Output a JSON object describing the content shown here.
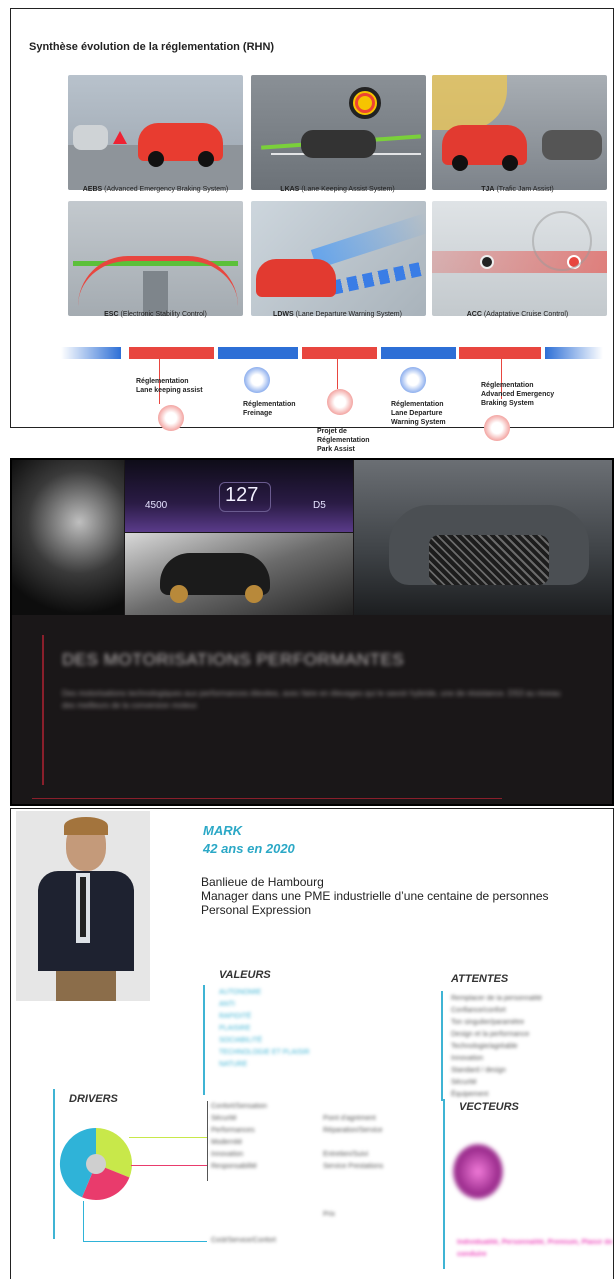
{
  "slide1": {
    "title": "Synthèse évolution de la réglementation (RHN)",
    "systems": [
      {
        "abbr": "AEBS",
        "desc": "(Advanced Emergency Braking System)"
      },
      {
        "abbr": "LKAS",
        "desc": "(Lane Keeping Assist System)"
      },
      {
        "abbr": "TJA",
        "desc": "(Trafic Jam Assist)"
      },
      {
        "abbr": "ESC",
        "desc": "(Electronic Stability Control)"
      },
      {
        "abbr": "LDWS",
        "desc": "(Lane Departure Warning System)"
      },
      {
        "abbr": "ACC",
        "desc": "(Adaptative Cruise Control)"
      }
    ],
    "timeline": [
      {
        "label": "Réglementation\nLane keeping assist"
      },
      {
        "label": "Réglementation\nFreinage"
      },
      {
        "label": "Projet de\nRéglementation\nPark Assist"
      },
      {
        "label": "Réglementation\nLane Departure\nWarning System"
      },
      {
        "label": "Réglementation\nAdvanced Emergency\nBraking System"
      }
    ],
    "colors": {
      "red": "#e8463f",
      "blue": "#2d6fd6"
    }
  },
  "slide2": {
    "dash": {
      "left": "4500",
      "center": "127",
      "right": "D5"
    },
    "heading": "DES MOTORISATIONS PERFORMANTES",
    "body": "Des motorisations technologiques aux performances élevées, avec faire en élevages qui le savoir hybride, une de résistance. DS3 au niveau des meilleurs de la conversion moteur.",
    "accent": "#8a1f2b"
  },
  "slide3": {
    "name": "MARK",
    "age": "42 ans en 2020",
    "info": [
      "Banlieue de Hambourg",
      "Manager dans une PME industrielle d’une centaine de personnes",
      "Personal Expression"
    ],
    "valeurs_title": "VALEURS",
    "valeurs": [
      "AUTONOMIE",
      "ANTI",
      "RAPIDITÉ",
      "PLAISIRE",
      "SOCIABILITÉ",
      "TECHNOLOGIE ET PLAISIR",
      "NATURE"
    ],
    "attentes_title": "ATTENTES",
    "attentes": [
      "Remplacer de la personnalité",
      "Confiance/confort",
      "Ton singulier/paramètre",
      "Design et la performance",
      "Technologie/agréable",
      "Innovation",
      "Standard / design",
      "Sécurité",
      "Équipement"
    ],
    "drivers_title": "DRIVERS",
    "drivers": [
      "Confort/Sensation",
      "Sécurité",
      "Performances",
      "Modernité",
      "Innovation",
      "Responsabilité"
    ],
    "drivers_right": [
      "Point d'agrément",
      "Réparation/Service",
      "Entretien/Suivi",
      "Service Prestations",
      "Prix"
    ],
    "drivers_bottom": "Coût/Service/Confort",
    "vecteurs_title": "VECTEURS",
    "vecteurs_text": "Individualité, Personnalité, Premium, Plaisir de conduire",
    "pie": [
      {
        "value": 33,
        "color": "#c8e84a"
      },
      {
        "value": 30,
        "color": "#e93b6c"
      },
      {
        "value": 37,
        "color": "#2fb3d8"
      }
    ]
  }
}
